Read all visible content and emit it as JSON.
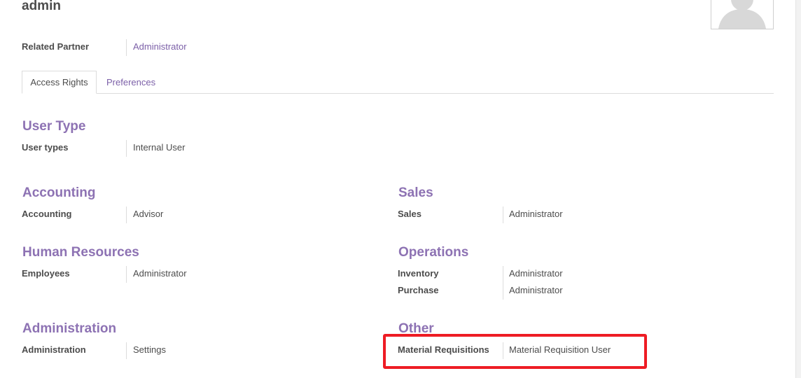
{
  "user": {
    "name": "admin"
  },
  "related_partner": {
    "label": "Related Partner",
    "value": "Administrator"
  },
  "tabs": [
    {
      "label": "Access Rights",
      "active": true
    },
    {
      "label": "Preferences",
      "active": false
    }
  ],
  "sections": {
    "user_type": {
      "title": "User Type",
      "fields": [
        {
          "label": "User types",
          "value": "Internal User"
        }
      ]
    },
    "accounting": {
      "title": "Accounting",
      "fields": [
        {
          "label": "Accounting",
          "value": "Advisor"
        }
      ]
    },
    "sales": {
      "title": "Sales",
      "fields": [
        {
          "label": "Sales",
          "value": "Administrator"
        }
      ]
    },
    "human_resources": {
      "title": "Human Resources",
      "fields": [
        {
          "label": "Employees",
          "value": "Administrator"
        }
      ]
    },
    "operations": {
      "title": "Operations",
      "fields": [
        {
          "label": "Inventory",
          "value": "Administrator"
        },
        {
          "label": "Purchase",
          "value": "Administrator"
        }
      ]
    },
    "administration": {
      "title": "Administration",
      "fields": [
        {
          "label": "Administration",
          "value": "Settings"
        }
      ]
    },
    "other": {
      "title": "Other",
      "fields": [
        {
          "label": "Material Requisitions",
          "value": "Material Requisition User"
        }
      ]
    }
  },
  "colors": {
    "section_title": "#8d72b3",
    "link": "#7c60a8",
    "highlight_box": "#ee1c24"
  },
  "icons": {
    "avatar": "avatar-placeholder-icon"
  }
}
